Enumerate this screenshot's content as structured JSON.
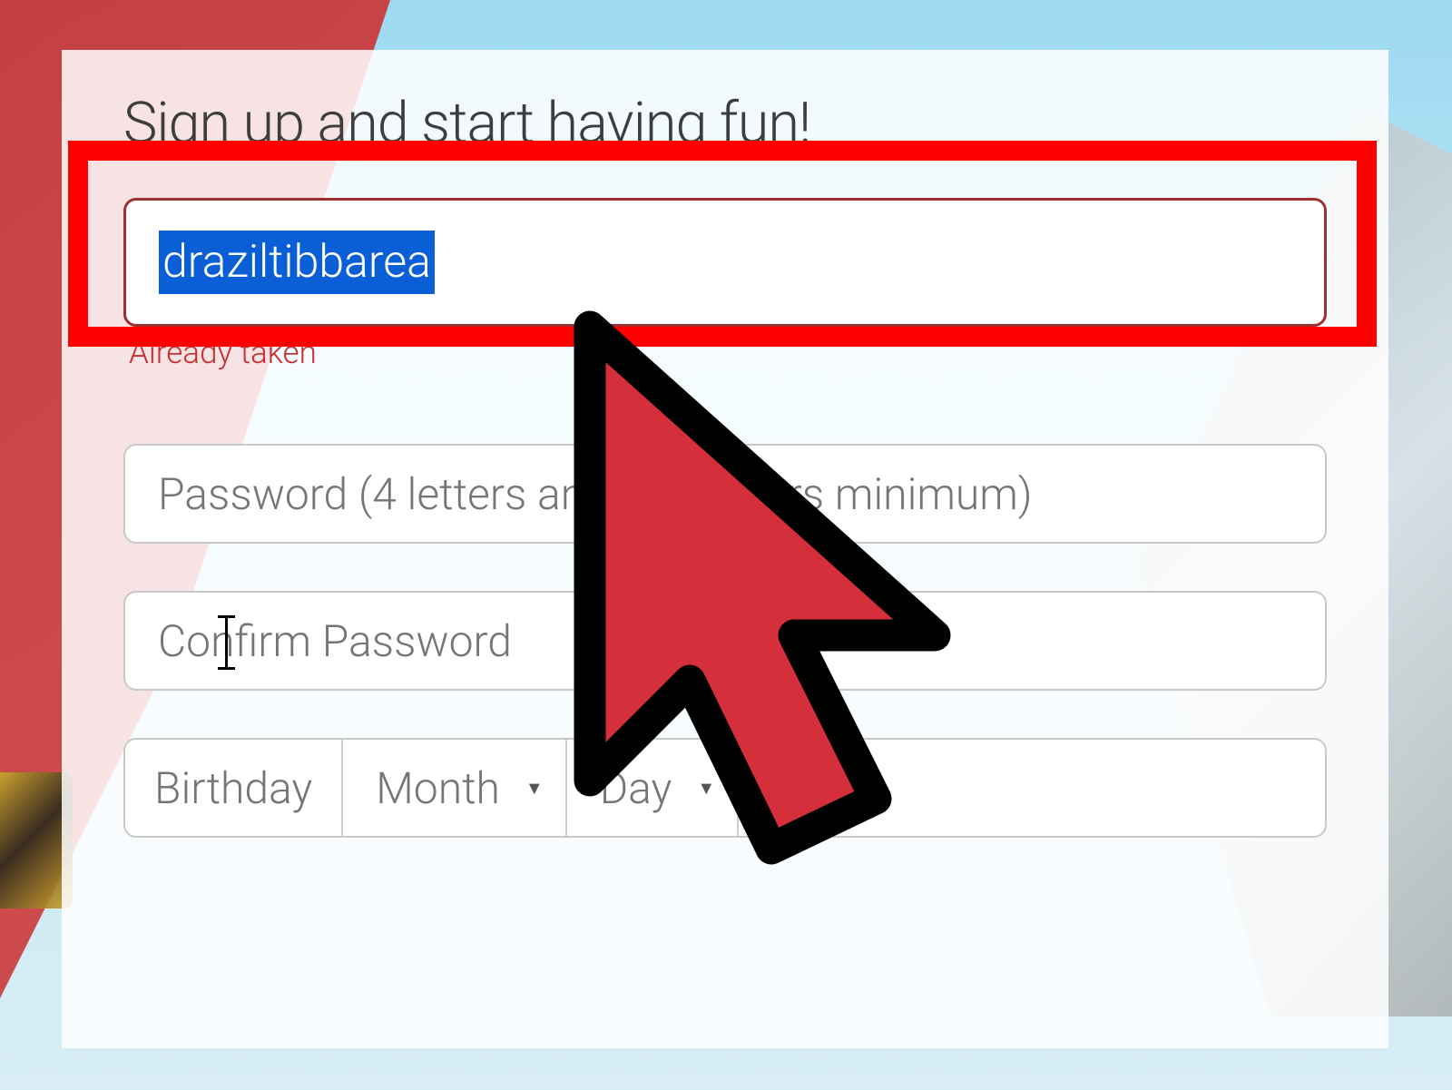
{
  "form": {
    "title": "Sign up and start having fun!",
    "username": {
      "value": "draziltibbarea",
      "error": "Already taken"
    },
    "password": {
      "placeholder": "Password (4 letters and 2 numbers minimum)"
    },
    "confirmPassword": {
      "placeholder": "Confirm Password"
    },
    "birthday": {
      "label": "Birthday",
      "month": "Month",
      "day": "Day"
    }
  },
  "colors": {
    "highlight": "#fe0000",
    "cursorFill": "#d62f3c",
    "selectionBg": "#0a5fd6",
    "errorText": "#c83030"
  }
}
